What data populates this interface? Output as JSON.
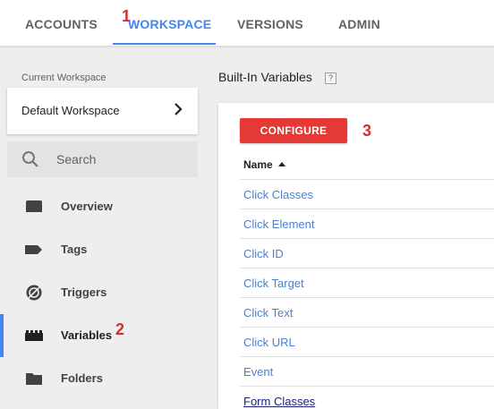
{
  "top_nav": {
    "tabs": [
      {
        "label": "ACCOUNTS"
      },
      {
        "label": "WORKSPACE"
      },
      {
        "label": "VERSIONS"
      },
      {
        "label": "ADMIN"
      }
    ],
    "active_tab": "WORKSPACE",
    "accent_color": "#4285f4"
  },
  "annotations": [
    "1",
    "2",
    "3"
  ],
  "sidebar": {
    "workspace_label": "Current Workspace",
    "workspace_name": "Default Workspace",
    "search_placeholder": "Search",
    "items": [
      {
        "label": "Overview",
        "icon": "folder-tab-icon"
      },
      {
        "label": "Tags",
        "icon": "tag-icon"
      },
      {
        "label": "Triggers",
        "icon": "trigger-icon"
      },
      {
        "label": "Variables",
        "icon": "variables-block-icon",
        "active": true
      },
      {
        "label": "Folders",
        "icon": "folder-icon"
      }
    ]
  },
  "main": {
    "title": "Built-In Variables",
    "help": "?",
    "configure_label": "CONFIGURE",
    "configure_color": "#e53935",
    "column_header": "Name",
    "rows": [
      "Click Classes",
      "Click Element",
      "Click ID",
      "Click Target",
      "Click Text",
      "Click URL",
      "Event",
      "Form Classes"
    ]
  }
}
